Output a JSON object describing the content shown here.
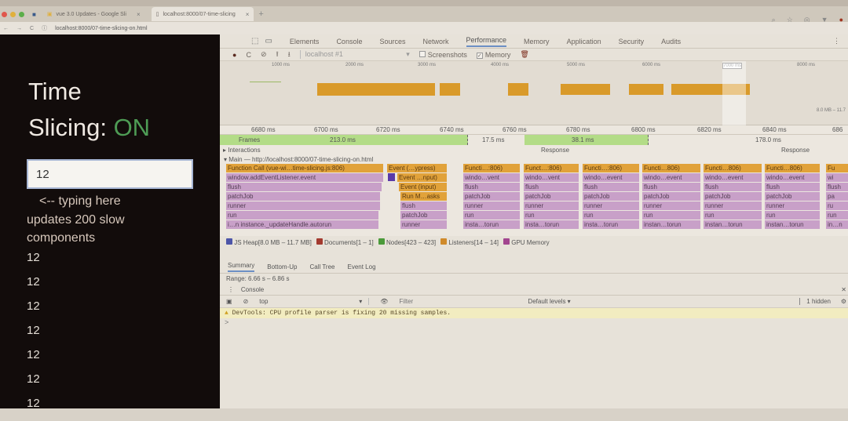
{
  "browser": {
    "tabs": [
      {
        "label": "vue 3.0 Updates - Google Sli",
        "close": "×"
      },
      {
        "label": "localhost:8000/07-time-slicing",
        "close": "×"
      }
    ],
    "new_tab": "+",
    "url": "localhost:8000/07-time-slicing-on.html"
  },
  "page": {
    "title_line1": "Time",
    "title_line2": "Slicing:",
    "status": "ON",
    "status_color": "#4e9c55",
    "input_value": "12",
    "hint_line1": "<-- typing here",
    "hint_line2": "updates 200 slow components",
    "outputs": [
      "12",
      "12",
      "12",
      "12",
      "12",
      "12",
      "12"
    ]
  },
  "devtools": {
    "tabs": [
      "Elements",
      "Console",
      "Sources",
      "Network",
      "Performance",
      "Memory",
      "Application",
      "Security",
      "Audits"
    ],
    "active_tab": "Performance",
    "toolbar": {
      "profile_select": "localhost #1",
      "screenshots_label": "Screenshots",
      "screenshots_checked": false,
      "memory_label": "Memory",
      "memory_checked": true
    },
    "overview_ticks": [
      "1000 ms",
      "2000 ms",
      "3000 ms",
      "4000 ms",
      "5000 ms",
      "6000 ms",
      "7000 ms",
      "8000 ms"
    ],
    "heap_range_label": "8.0 MB – 11.7",
    "ruler_ticks": [
      "6680 ms",
      "6700 ms",
      "6720 ms",
      "6740 ms",
      "6760 ms",
      "6780 ms",
      "6800 ms",
      "6820 ms",
      "6840 ms",
      "686"
    ],
    "frames": {
      "label": "Frames",
      "values": [
        "213.0 ms",
        "17.5 ms",
        "38.1 ms",
        "178.0 ms"
      ]
    },
    "interactions": {
      "label": "Interactions",
      "responses": [
        "Response",
        "Response"
      ]
    },
    "main_label": "Main — http://localhost:8000/07-time-slicing-on.html",
    "flame": {
      "block1": [
        "Function Call (vue-wi…time-slicing.js:806)",
        "window.addEventListener.event",
        "flush",
        "patchJob",
        "runner",
        "run",
        "i…n   instance._updateHandle.autorun"
      ],
      "block2": [
        "Event (…ypress)",
        "Event …nput)",
        "Event (input)",
        "Run M…asks",
        "flush",
        "patchJob",
        "runner"
      ],
      "slices": [
        [
          "Functi…:806)",
          "windo…vent",
          "flush",
          "patchJob",
          "runner",
          "run",
          "insta…torun"
        ],
        [
          "Funct…:806)",
          "windo…vent",
          "flush",
          "patchJob",
          "runner",
          "run",
          "insta…torun"
        ],
        [
          "Functi…:806)",
          "windo…event",
          "flush",
          "patchJob",
          "runner",
          "run",
          "insta…torun"
        ],
        [
          "Functi…806)",
          "windo…event",
          "flush",
          "patchJob",
          "runner",
          "run",
          "instan…torun"
        ],
        [
          "Functi…806)",
          "windo…event",
          "flush",
          "patchJob",
          "runner",
          "run",
          "instan…torun"
        ],
        [
          "Functi…806)",
          "windo…event",
          "flush",
          "patchJob",
          "runner",
          "run",
          "instan…torun"
        ],
        [
          "Fu",
          "wi",
          "flush",
          "pa",
          "ru",
          "run",
          "in…n"
        ]
      ]
    },
    "counters": [
      {
        "label": "JS Heap[8.0 MB – 11.7 MB]",
        "color": "#4d55a8"
      },
      {
        "label": "Documents[1 – 1]",
        "color": "#a33a2f"
      },
      {
        "label": "Nodes[423 – 423]",
        "color": "#4b9a3a"
      },
      {
        "label": "Listeners[14 – 14]",
        "color": "#d08a2a"
      },
      {
        "label": "GPU Memory",
        "color": "#a2458f"
      }
    ],
    "bottom_tabs": [
      "Summary",
      "Bottom-Up",
      "Call Tree",
      "Event Log"
    ],
    "range": "Range: 6.66 s – 6.86 s",
    "drawer": {
      "title": "Console",
      "context": "top",
      "filter_placeholder": "Filter",
      "levels": "Default levels ▾",
      "hidden": "1 hidden",
      "warning": "DevTools: CPU profile parser is fixing 20 missing samples.",
      "prompt": ">"
    }
  }
}
